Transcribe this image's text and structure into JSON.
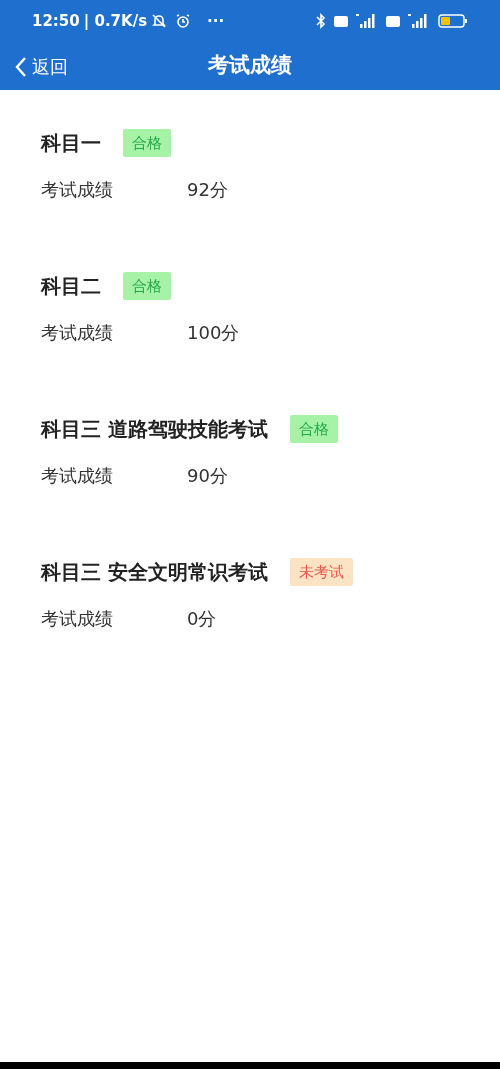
{
  "status_bar": {
    "time": "12:50",
    "network_speed": "| 0.7K/s",
    "more": "···"
  },
  "header": {
    "back": "返回",
    "title": "考试成绩"
  },
  "subjects": [
    {
      "name": "科目一",
      "status": {
        "kind": "passed",
        "label": "合格"
      },
      "score_label": "考试成绩",
      "score": "92分"
    },
    {
      "name": "科目二",
      "status": {
        "kind": "passed",
        "label": "合格"
      },
      "score_label": "考试成绩",
      "score": "100分"
    },
    {
      "name": "科目三 道路驾驶技能考试",
      "status": {
        "kind": "passed",
        "label": "合格"
      },
      "score_label": "考试成绩",
      "score": "90分"
    },
    {
      "name": "科目三 安全文明常识考试",
      "status": {
        "kind": "not_taken",
        "label": "未考试"
      },
      "score_label": "考试成绩",
      "score": "0分"
    }
  ]
}
